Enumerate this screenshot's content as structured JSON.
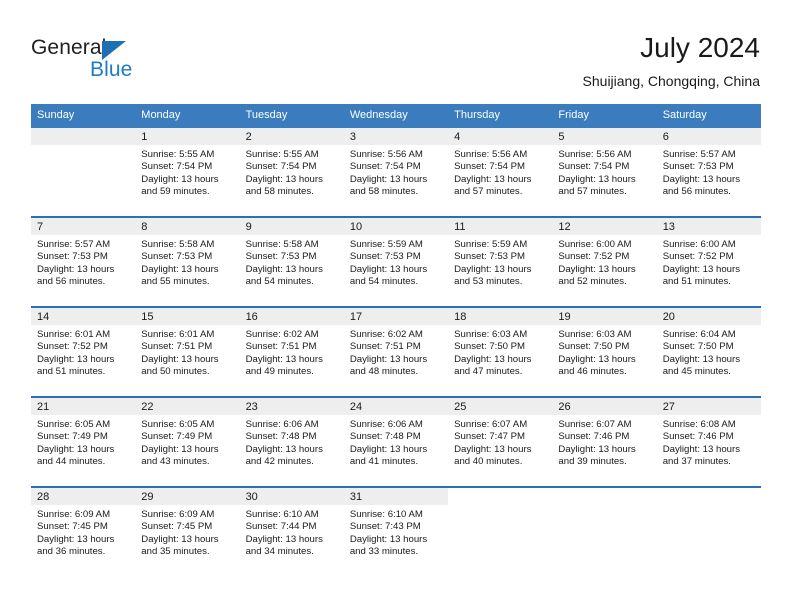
{
  "brand": {
    "name_part1": "General",
    "name_part2": "Blue",
    "triangle_color": "#1f6fb5",
    "blue_color": "#1f7cc4"
  },
  "header": {
    "title": "July 2024",
    "subtitle": "Shuijiang, Chongqing, China"
  },
  "theme": {
    "header_row_bg": "#3a7cbe",
    "row_divider": "#2d6fb3",
    "daynum_band_bg": "#eeeeee",
    "text": "#1a1a1a"
  },
  "weekday_headers": [
    "Sunday",
    "Monday",
    "Tuesday",
    "Wednesday",
    "Thursday",
    "Friday",
    "Saturday"
  ],
  "weeks": [
    [
      {
        "day": "",
        "sunrise": "",
        "sunset": "",
        "daylight_line1": "",
        "daylight_line2": "",
        "empty": true
      },
      {
        "day": "1",
        "sunrise": "Sunrise: 5:55 AM",
        "sunset": "Sunset: 7:54 PM",
        "daylight_line1": "Daylight: 13 hours",
        "daylight_line2": "and 59 minutes."
      },
      {
        "day": "2",
        "sunrise": "Sunrise: 5:55 AM",
        "sunset": "Sunset: 7:54 PM",
        "daylight_line1": "Daylight: 13 hours",
        "daylight_line2": "and 58 minutes."
      },
      {
        "day": "3",
        "sunrise": "Sunrise: 5:56 AM",
        "sunset": "Sunset: 7:54 PM",
        "daylight_line1": "Daylight: 13 hours",
        "daylight_line2": "and 58 minutes."
      },
      {
        "day": "4",
        "sunrise": "Sunrise: 5:56 AM",
        "sunset": "Sunset: 7:54 PM",
        "daylight_line1": "Daylight: 13 hours",
        "daylight_line2": "and 57 minutes."
      },
      {
        "day": "5",
        "sunrise": "Sunrise: 5:56 AM",
        "sunset": "Sunset: 7:54 PM",
        "daylight_line1": "Daylight: 13 hours",
        "daylight_line2": "and 57 minutes."
      },
      {
        "day": "6",
        "sunrise": "Sunrise: 5:57 AM",
        "sunset": "Sunset: 7:53 PM",
        "daylight_line1": "Daylight: 13 hours",
        "daylight_line2": "and 56 minutes."
      }
    ],
    [
      {
        "day": "7",
        "sunrise": "Sunrise: 5:57 AM",
        "sunset": "Sunset: 7:53 PM",
        "daylight_line1": "Daylight: 13 hours",
        "daylight_line2": "and 56 minutes."
      },
      {
        "day": "8",
        "sunrise": "Sunrise: 5:58 AM",
        "sunset": "Sunset: 7:53 PM",
        "daylight_line1": "Daylight: 13 hours",
        "daylight_line2": "and 55 minutes."
      },
      {
        "day": "9",
        "sunrise": "Sunrise: 5:58 AM",
        "sunset": "Sunset: 7:53 PM",
        "daylight_line1": "Daylight: 13 hours",
        "daylight_line2": "and 54 minutes."
      },
      {
        "day": "10",
        "sunrise": "Sunrise: 5:59 AM",
        "sunset": "Sunset: 7:53 PM",
        "daylight_line1": "Daylight: 13 hours",
        "daylight_line2": "and 54 minutes."
      },
      {
        "day": "11",
        "sunrise": "Sunrise: 5:59 AM",
        "sunset": "Sunset: 7:53 PM",
        "daylight_line1": "Daylight: 13 hours",
        "daylight_line2": "and 53 minutes."
      },
      {
        "day": "12",
        "sunrise": "Sunrise: 6:00 AM",
        "sunset": "Sunset: 7:52 PM",
        "daylight_line1": "Daylight: 13 hours",
        "daylight_line2": "and 52 minutes."
      },
      {
        "day": "13",
        "sunrise": "Sunrise: 6:00 AM",
        "sunset": "Sunset: 7:52 PM",
        "daylight_line1": "Daylight: 13 hours",
        "daylight_line2": "and 51 minutes."
      }
    ],
    [
      {
        "day": "14",
        "sunrise": "Sunrise: 6:01 AM",
        "sunset": "Sunset: 7:52 PM",
        "daylight_line1": "Daylight: 13 hours",
        "daylight_line2": "and 51 minutes."
      },
      {
        "day": "15",
        "sunrise": "Sunrise: 6:01 AM",
        "sunset": "Sunset: 7:51 PM",
        "daylight_line1": "Daylight: 13 hours",
        "daylight_line2": "and 50 minutes."
      },
      {
        "day": "16",
        "sunrise": "Sunrise: 6:02 AM",
        "sunset": "Sunset: 7:51 PM",
        "daylight_line1": "Daylight: 13 hours",
        "daylight_line2": "and 49 minutes."
      },
      {
        "day": "17",
        "sunrise": "Sunrise: 6:02 AM",
        "sunset": "Sunset: 7:51 PM",
        "daylight_line1": "Daylight: 13 hours",
        "daylight_line2": "and 48 minutes."
      },
      {
        "day": "18",
        "sunrise": "Sunrise: 6:03 AM",
        "sunset": "Sunset: 7:50 PM",
        "daylight_line1": "Daylight: 13 hours",
        "daylight_line2": "and 47 minutes."
      },
      {
        "day": "19",
        "sunrise": "Sunrise: 6:03 AM",
        "sunset": "Sunset: 7:50 PM",
        "daylight_line1": "Daylight: 13 hours",
        "daylight_line2": "and 46 minutes."
      },
      {
        "day": "20",
        "sunrise": "Sunrise: 6:04 AM",
        "sunset": "Sunset: 7:50 PM",
        "daylight_line1": "Daylight: 13 hours",
        "daylight_line2": "and 45 minutes."
      }
    ],
    [
      {
        "day": "21",
        "sunrise": "Sunrise: 6:05 AM",
        "sunset": "Sunset: 7:49 PM",
        "daylight_line1": "Daylight: 13 hours",
        "daylight_line2": "and 44 minutes."
      },
      {
        "day": "22",
        "sunrise": "Sunrise: 6:05 AM",
        "sunset": "Sunset: 7:49 PM",
        "daylight_line1": "Daylight: 13 hours",
        "daylight_line2": "and 43 minutes."
      },
      {
        "day": "23",
        "sunrise": "Sunrise: 6:06 AM",
        "sunset": "Sunset: 7:48 PM",
        "daylight_line1": "Daylight: 13 hours",
        "daylight_line2": "and 42 minutes."
      },
      {
        "day": "24",
        "sunrise": "Sunrise: 6:06 AM",
        "sunset": "Sunset: 7:48 PM",
        "daylight_line1": "Daylight: 13 hours",
        "daylight_line2": "and 41 minutes."
      },
      {
        "day": "25",
        "sunrise": "Sunrise: 6:07 AM",
        "sunset": "Sunset: 7:47 PM",
        "daylight_line1": "Daylight: 13 hours",
        "daylight_line2": "and 40 minutes."
      },
      {
        "day": "26",
        "sunrise": "Sunrise: 6:07 AM",
        "sunset": "Sunset: 7:46 PM",
        "daylight_line1": "Daylight: 13 hours",
        "daylight_line2": "and 39 minutes."
      },
      {
        "day": "27",
        "sunrise": "Sunrise: 6:08 AM",
        "sunset": "Sunset: 7:46 PM",
        "daylight_line1": "Daylight: 13 hours",
        "daylight_line2": "and 37 minutes."
      }
    ],
    [
      {
        "day": "28",
        "sunrise": "Sunrise: 6:09 AM",
        "sunset": "Sunset: 7:45 PM",
        "daylight_line1": "Daylight: 13 hours",
        "daylight_line2": "and 36 minutes."
      },
      {
        "day": "29",
        "sunrise": "Sunrise: 6:09 AM",
        "sunset": "Sunset: 7:45 PM",
        "daylight_line1": "Daylight: 13 hours",
        "daylight_line2": "and 35 minutes."
      },
      {
        "day": "30",
        "sunrise": "Sunrise: 6:10 AM",
        "sunset": "Sunset: 7:44 PM",
        "daylight_line1": "Daylight: 13 hours",
        "daylight_line2": "and 34 minutes."
      },
      {
        "day": "31",
        "sunrise": "Sunrise: 6:10 AM",
        "sunset": "Sunset: 7:43 PM",
        "daylight_line1": "Daylight: 13 hours",
        "daylight_line2": "and 33 minutes."
      },
      {
        "day": "",
        "sunrise": "",
        "sunset": "",
        "daylight_line1": "",
        "daylight_line2": "",
        "trailing": true
      },
      {
        "day": "",
        "sunrise": "",
        "sunset": "",
        "daylight_line1": "",
        "daylight_line2": "",
        "trailing": true
      },
      {
        "day": "",
        "sunrise": "",
        "sunset": "",
        "daylight_line1": "",
        "daylight_line2": "",
        "trailing": true
      }
    ]
  ]
}
